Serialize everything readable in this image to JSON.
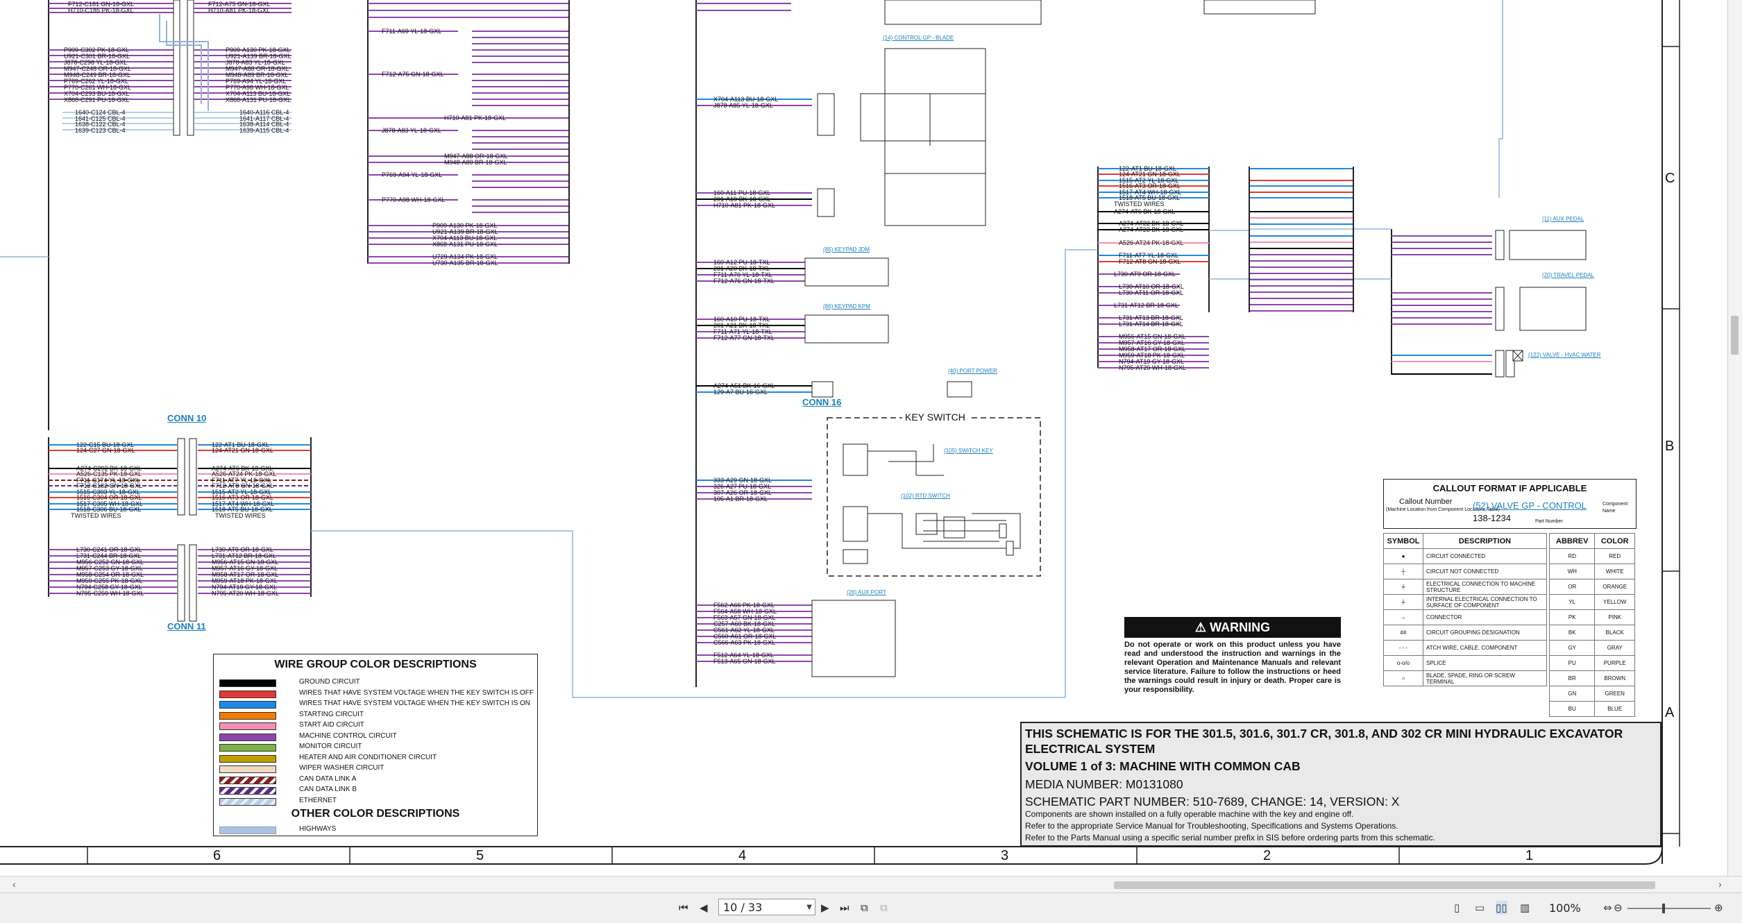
{
  "conn_labels": {
    "conn10": "CONN 10",
    "conn11": "CONN 11",
    "conn16": "CONN 16"
  },
  "callouts": {
    "control_blade": "(14) CONTROL GP - BLADE",
    "keypad_jdm": "(85) KEYPAD JDM",
    "keypad_kpm": "(86) KEYPAD KPM",
    "port_power": "(40) PORT POWER",
    "switch_key": "(105) SWITCH KEY",
    "rtd_switch": "(102) RTD SWITCH",
    "aux_port": "(26) AUX PORT",
    "aux_pedal": "(11) AUX PEDAL",
    "travel_pedal": "(20) TRAVEL PEDAL",
    "hvac_valve": "(122) VALVE - HVAC WATER"
  },
  "key_switch_title": "KEY SWITCH",
  "wire_labels_left_top": [
    "F712-C181 GN-18-GXL",
    "H710-C185 PK-18-GXL",
    "P909-C302 PK-18-GXL",
    "U921-C301 BR-18-GXL",
    "J878-C298 YL-18-GXL",
    "M947-C248 OR-18-GXL",
    "M948-C249 BR-18-GXL",
    "P769-C262 YL-18-GXL",
    "P770-C261 WH-18-GXL",
    "X704-C293 BU-18-GXL",
    "X868-C291 PU-18-GXL",
    "1640-C124 CBL-4",
    "1641-C125 CBL-4",
    "1638-C122 CBL-4",
    "1639-C123 CBL-4"
  ],
  "wire_labels_left_mid": [
    "F712-A75 GN-18-GXL",
    "H710-A81 PK-18-GXL",
    "P909-A130 PK-18-GXL",
    "U921-A139 BR-18-GXL",
    "J878-A83 YL-18-GXL",
    "M947-A88 OR-18-GXL",
    "M948-A89 BR-18-GXL",
    "P769-A94 YL-18-GXL",
    "P770-A98 WH-18-GXL",
    "X704-A113 BU-18-GXL",
    "X868-A131 PU-18-GXL",
    "1640-A116 CBL-4",
    "1641-A117 CBL-4",
    "1638-A114 CBL-4",
    "1639-A115 CBL-4"
  ],
  "wire_labels_col3": [
    "F711-A69 YL-18-GXL",
    "F712-A75 GN-18-GXL",
    "H710-A81 PK-18-GXL",
    "J878-A83 YL-18-GXL",
    "M947-A88 OR-18-GXL",
    "M948-A89 BR-18-GXL",
    "P769-A94 YL-18-GXL",
    "P770-A98 WH-18-GXL",
    "P909-A130 PK-18-GXL",
    "U921-A139 BR-18-GXL",
    "X704-A113 BU-18-GXL",
    "X868-A131 PU-18-GXL",
    "U729-A134 PK-18-GXL",
    "U730-A135 BR-18-GXL"
  ],
  "conn10_left": [
    "122-C15 BU-18-GXL",
    "124-C27 GN-18-GXL",
    "A274-C292 BK-18-GXL",
    "A526-C135 PK-18-GXL",
    "F711-C174 YL-18-GXL",
    "F712-C182 GN-18-GXL",
    "1515-C303 YL-18-GXL",
    "1516-C304 OR-18-GXL",
    "1517-C305 WH-18-GXL",
    "1518-C306 BU-18-GXL",
    "TWISTED WIRES"
  ],
  "conn10_right": [
    "122-AT1 BU-18-GXL",
    "124-AT21 GN-18-GXL",
    "A274-AT6 BK-18-GXL",
    "A526-AT24 PK-18-GXL",
    "F711-AT7 YL-18-GXL",
    "F712-AT8 GN-18-GXL",
    "1515-AT2 YL-18-GXL",
    "1516-AT3 OR-18-GXL",
    "1517-AT4 WH-18-GXL",
    "1518-AT5 BU-18-GXL",
    "TWISTED WIRES"
  ],
  "conn11_left": [
    "L730-C241 OR-18-GXL",
    "L731-C244 BR-18-GXL",
    "M956-C252 GN-18-GXL",
    "M957-C253 GY-18-GXL",
    "M958-C254 OR-18-GXL",
    "M959-C255 PK-18-GXL",
    "N794-C258 GY-18-GXL",
    "N795-C259 WH-18-GXL"
  ],
  "conn11_right": [
    "L730-AT9 OR-18-GXL",
    "L731-AT12 BR-18-GXL",
    "M956-AT15 GN-18-GXL",
    "M957-AT16 GY-18-GXL",
    "M958-AT17 OR-18-GXL",
    "M959-AT18 PK-18-GXL",
    "N794-AT19 GY-18-GXL",
    "N795-AT20 WH-18-GXL"
  ],
  "col4_labels": [
    "X704-A113 BU-18-GXL",
    "J878-A85 YL-18-GXL",
    "160-A11 PU-18-GXL",
    "201-A19 BK-18-GXL",
    "H710-A81 PK-18-GXL",
    "160-A12 PU-18-TXL",
    "201-A20 BK-18-TXL",
    "F711-A70 YL-18-TXL",
    "F712-A76 GN-18-TXL",
    "160-A10 PU-18-TXL",
    "201-A21 BK-18-TXL",
    "F711-A71 YL-18-TXL",
    "F712-A77 GN-18-TXL",
    "A274-A51 BK-16-GXL",
    "129-A7 BU-16-GXL",
    "333-A29 GN-18-GXL",
    "326-A27 PU-18-GXL",
    "307-A26 OR-18-GXL",
    "105-A1 BR-18-GXL",
    "F562-A66 PK-18-GXL",
    "F564-A58 WH-18-GXL",
    "F563-A57 GN-18-GXL",
    "C257-A60 BK-18-GXL",
    "C561-A62 YL-18-GXL",
    "C560-A61 OR-18-GXL",
    "C566-A63 PK-18-GXL",
    "F512-A64 YL-18-GXL",
    "F513-A65 GN-18-GXL"
  ],
  "col5_labels": [
    "122-AT1 BU-18-GXL",
    "124-AT21 GN-18-GXL",
    "1515-AT2 YL-18-GXL",
    "1516-AT3 OR-18-GXL",
    "1517-AT4 WH-18-GXL",
    "1518-AT5 BU-18-GXL",
    "TWISTED WIRES",
    "A274-AT6 BK-18-GXL",
    "A274-AT22 BK-18-GXL",
    "A274-AT23 BK-18-GXL",
    "A526-AT24 PK-18-GXL",
    "F711-AT7 YL-18-GXL",
    "F712-AT8 GN-18-GXL",
    "L730-AT9 OR-18-GXL",
    "L730-AT10 OR-18-GXL",
    "L730-AT11 OR-18-GXL",
    "L731-AT12 BR-18-GXL",
    "L731-AT13 BR-18-GXL",
    "L731-AT14 BR-18-GXL",
    "M956-AT15 GN-18-GXL",
    "M957-AT16 GY-18-GXL",
    "M958-AT17 OR-18-GXL",
    "M959-AT18 PK-18-GXL",
    "N794-AT19 GY-18-GXL",
    "N795-AT20 WH-18-GXL"
  ],
  "legend": {
    "title": "WIRE GROUP COLOR DESCRIPTIONS",
    "items": [
      {
        "label": "GROUND CIRCUIT",
        "color": "#000000"
      },
      {
        "label": "WIRES THAT HAVE SYSTEM VOLTAGE WHEN THE KEY SWITCH IS OFF",
        "color": "#e53935"
      },
      {
        "label": "WIRES THAT HAVE SYSTEM VOLTAGE WHEN THE KEY SWITCH IS ON",
        "color": "#1e88e5"
      },
      {
        "label": "STARTING CIRCUIT",
        "color": "#f57c00"
      },
      {
        "label": "START AID CIRCUIT",
        "color": "#f48fb1"
      },
      {
        "label": "MACHINE CONTROL CIRCUIT",
        "color": "#8e44ad"
      },
      {
        "label": "MONITOR CIRCUIT",
        "color": "#7cb342"
      },
      {
        "label": "HEATER AND AIR CONDITIONER CIRCUIT",
        "color": "#c0a000"
      },
      {
        "label": "WIPER WASHER CIRCUIT",
        "color": "#f3d9c0"
      },
      {
        "label": "CAN DATA LINK A",
        "color": "#8a1c1c"
      },
      {
        "label": "CAN DATA LINK B",
        "color": "#5b2a86"
      },
      {
        "label": "ETHERNET",
        "color": "#b7cde8"
      }
    ],
    "other_title": "OTHER COLOR DESCRIPTIONS",
    "other_items": [
      {
        "label": "HIGHWAYS",
        "color": "#a9c4e6"
      }
    ]
  },
  "callout_format": {
    "title": "CALLOUT FORMAT IF APPLICABLE",
    "callout_number": "Callout Number",
    "location_note": "(Machine Location from Component Locations Table)",
    "example": "(52) VALVE GP - CONTROL",
    "part": "138-1234",
    "component_name": "Component Name",
    "part_number": "Part Number"
  },
  "symbols": {
    "header_symbol": "SYMBOL",
    "header_desc": "DESCRIPTION",
    "rows": [
      "CIRCUIT CONNECTED",
      "CIRCUIT NOT CONNECTED",
      "ELECTRICAL CONNECTION TO MACHINE STRUCTURE",
      "INTERNAL ELECTRICAL CONNECTION TO SURFACE OF COMPONENT",
      "CONNECTOR",
      "CIRCUIT GROUPING DESIGNATION",
      "ATCH WIRE, CABLE, COMPONENT",
      "SPLICE",
      "BLADE, SPADE, RING OR SCREW TERMINAL"
    ]
  },
  "abbrev": {
    "header_abbrev": "ABBREV",
    "header_color": "COLOR",
    "rows": [
      [
        "RD",
        "RED"
      ],
      [
        "WH",
        "WHITE"
      ],
      [
        "OR",
        "ORANGE"
      ],
      [
        "YL",
        "YELLOW"
      ],
      [
        "PK",
        "PINK"
      ],
      [
        "BK",
        "BLACK"
      ],
      [
        "GY",
        "GRAY"
      ],
      [
        "PU",
        "PURPLE"
      ],
      [
        "BR",
        "BROWN"
      ],
      [
        "GN",
        "GREEN"
      ],
      [
        "BU",
        "BLUE"
      ]
    ]
  },
  "warning": {
    "title": "WARNING",
    "body": "Do not operate or work on this product unless you have read and understood the instruction and warnings in the relevant Operation and Maintenance Manuals and relevant service literature. Failure to follow the instructions or heed the warnings could result in injury or death. Proper care is your responsibility."
  },
  "title_block": {
    "line1": "THIS SCHEMATIC IS FOR THE 301.5, 301.6, 301.7 CR, 301.8, AND 302 CR MINI HYDRAULIC EXCAVATOR",
    "line2": "ELECTRICAL SYSTEM",
    "line3": "VOLUME 1 of 3: MACHINE WITH COMMON CAB",
    "line4": "MEDIA NUMBER: M0131080",
    "line5": "SCHEMATIC PART NUMBER: 510-7689, CHANGE: 14, VERSION: X",
    "note1": "Components are shown installed on a fully operable machine with the key and engine off.",
    "note2": "Refer to the appropriate Service Manual for Troubleshooting, Specifications and Systems Operations.",
    "note3": "Refer to the Parts Manual using a specific serial number prefix in SIS before ordering parts from this schematic."
  },
  "grid": {
    "columns": [
      "6",
      "5",
      "4",
      "3",
      "2",
      "1"
    ],
    "rows": [
      "C",
      "B",
      "A"
    ]
  },
  "viewer": {
    "page_indicator": "10 / 33",
    "zoom": "100%"
  }
}
